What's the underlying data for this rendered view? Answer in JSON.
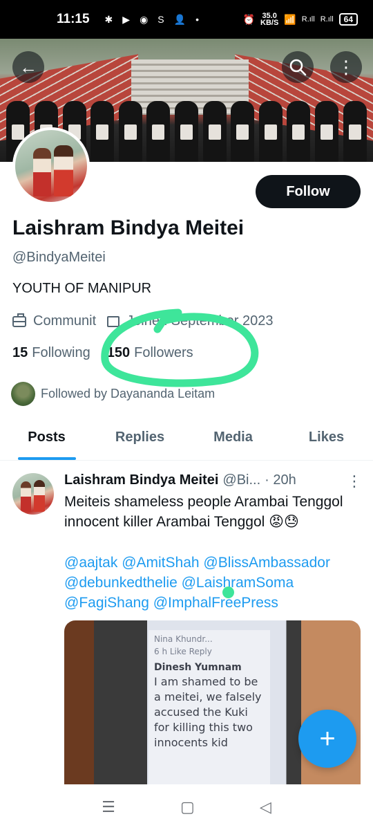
{
  "status": {
    "time": "11:15",
    "net_speed_value": "35.0",
    "net_speed_unit": "KB/S",
    "signal1": "R.ıll",
    "signal2": "R.ıll",
    "battery": "64"
  },
  "profile": {
    "display_name": "Laishram Bindya Meitei",
    "handle": "@BindyaMeitei",
    "bio": "YOUTH OF MANIPUR",
    "category": "Communit",
    "joined": "Joined September 2023",
    "following_count": "15",
    "following_label": "Following",
    "followers_count": "150",
    "followers_label": "Followers",
    "followed_by": "Followed by Dayananda Leitam",
    "follow_button": "Follow"
  },
  "tabs": [
    {
      "label": "Posts",
      "active": true
    },
    {
      "label": "Replies",
      "active": false
    },
    {
      "label": "Media",
      "active": false
    },
    {
      "label": "Likes",
      "active": false
    }
  ],
  "tweet": {
    "name": "Laishram Bindya Meitei",
    "handle": "@Bi...",
    "time": "· 20h",
    "text": "Meiteis shameless people Arambai Tenggol\n innocent killer  Arambai Tenggol 😡😓",
    "mentions": "@aajtak @AmitShah @BlissAmbassador @debunkedthelie @LaishramSoma @FagiShang @ImphalFreePress",
    "media": {
      "top": "Nina Khundr...",
      "like": "6 h   Like   Reply",
      "commenter": "Dinesh Yumnam",
      "comment": "I am shamed to be a meitei, we falsely accused the Kuki for killing this two innocents kid"
    }
  },
  "colors": {
    "accent": "#1d9bf0",
    "highlight_marker": "#3ee59a",
    "follow_button_bg": "#0f1419"
  },
  "icons": [
    "back-arrow-icon",
    "search-icon",
    "more-vertical-icon",
    "briefcase-icon",
    "calendar-icon",
    "plus-icon",
    "menu-icon",
    "home-square-icon",
    "back-triangle-icon"
  ]
}
